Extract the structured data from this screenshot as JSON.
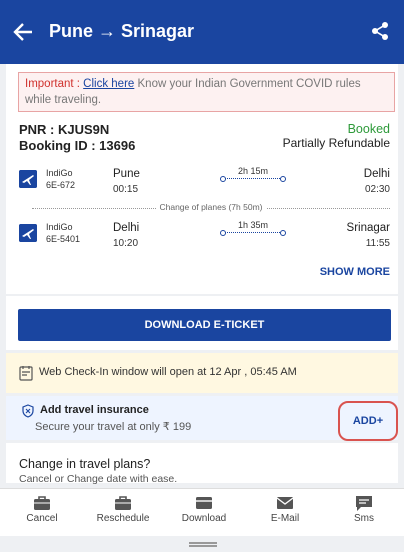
{
  "header": {
    "title": "Pune → Srinagar"
  },
  "notice": {
    "important": "Important :",
    "link": "Click here",
    "text": "Know your Indian Government COVID rules while traveling."
  },
  "booking": {
    "pnr": "PNR : KJUS9N",
    "booking_id": "Booking ID : 13696",
    "status": "Booked",
    "refund": "Partially Refundable"
  },
  "segments": [
    {
      "airline": "IndiGo",
      "flight": "6E-672",
      "from": "Pune",
      "dep": "00:15",
      "duration": "2h 15m",
      "to": "Delhi",
      "arr": "02:30"
    },
    {
      "airline": "IndiGo",
      "flight": "6E-5401",
      "from": "Delhi",
      "dep": "10:20",
      "duration": "1h 35m",
      "to": "Srinagar",
      "arr": "11:55"
    }
  ],
  "layover": "Change of planes (7h 50m)",
  "show_more": "SHOW MORE",
  "download_ticket": "DOWNLOAD E-TICKET",
  "checkin": {
    "text": "Web Check-In window will open at 12 Apr , 05:45 AM"
  },
  "insurance": {
    "title": "Add travel insurance",
    "subtitle": "Secure your travel at only ₹ 199",
    "add": "ADD+"
  },
  "change": {
    "title": "Change in travel plans?",
    "subtitle": "Cancel or Change date with ease."
  },
  "nav": {
    "cancel": "Cancel",
    "reschedule": "Reschedule",
    "download": "Download",
    "email": "E-Mail",
    "sms": "Sms"
  },
  "colors": {
    "brand": "#1a45a0",
    "booked": "#2e9a3a",
    "important": "#d0312d"
  }
}
